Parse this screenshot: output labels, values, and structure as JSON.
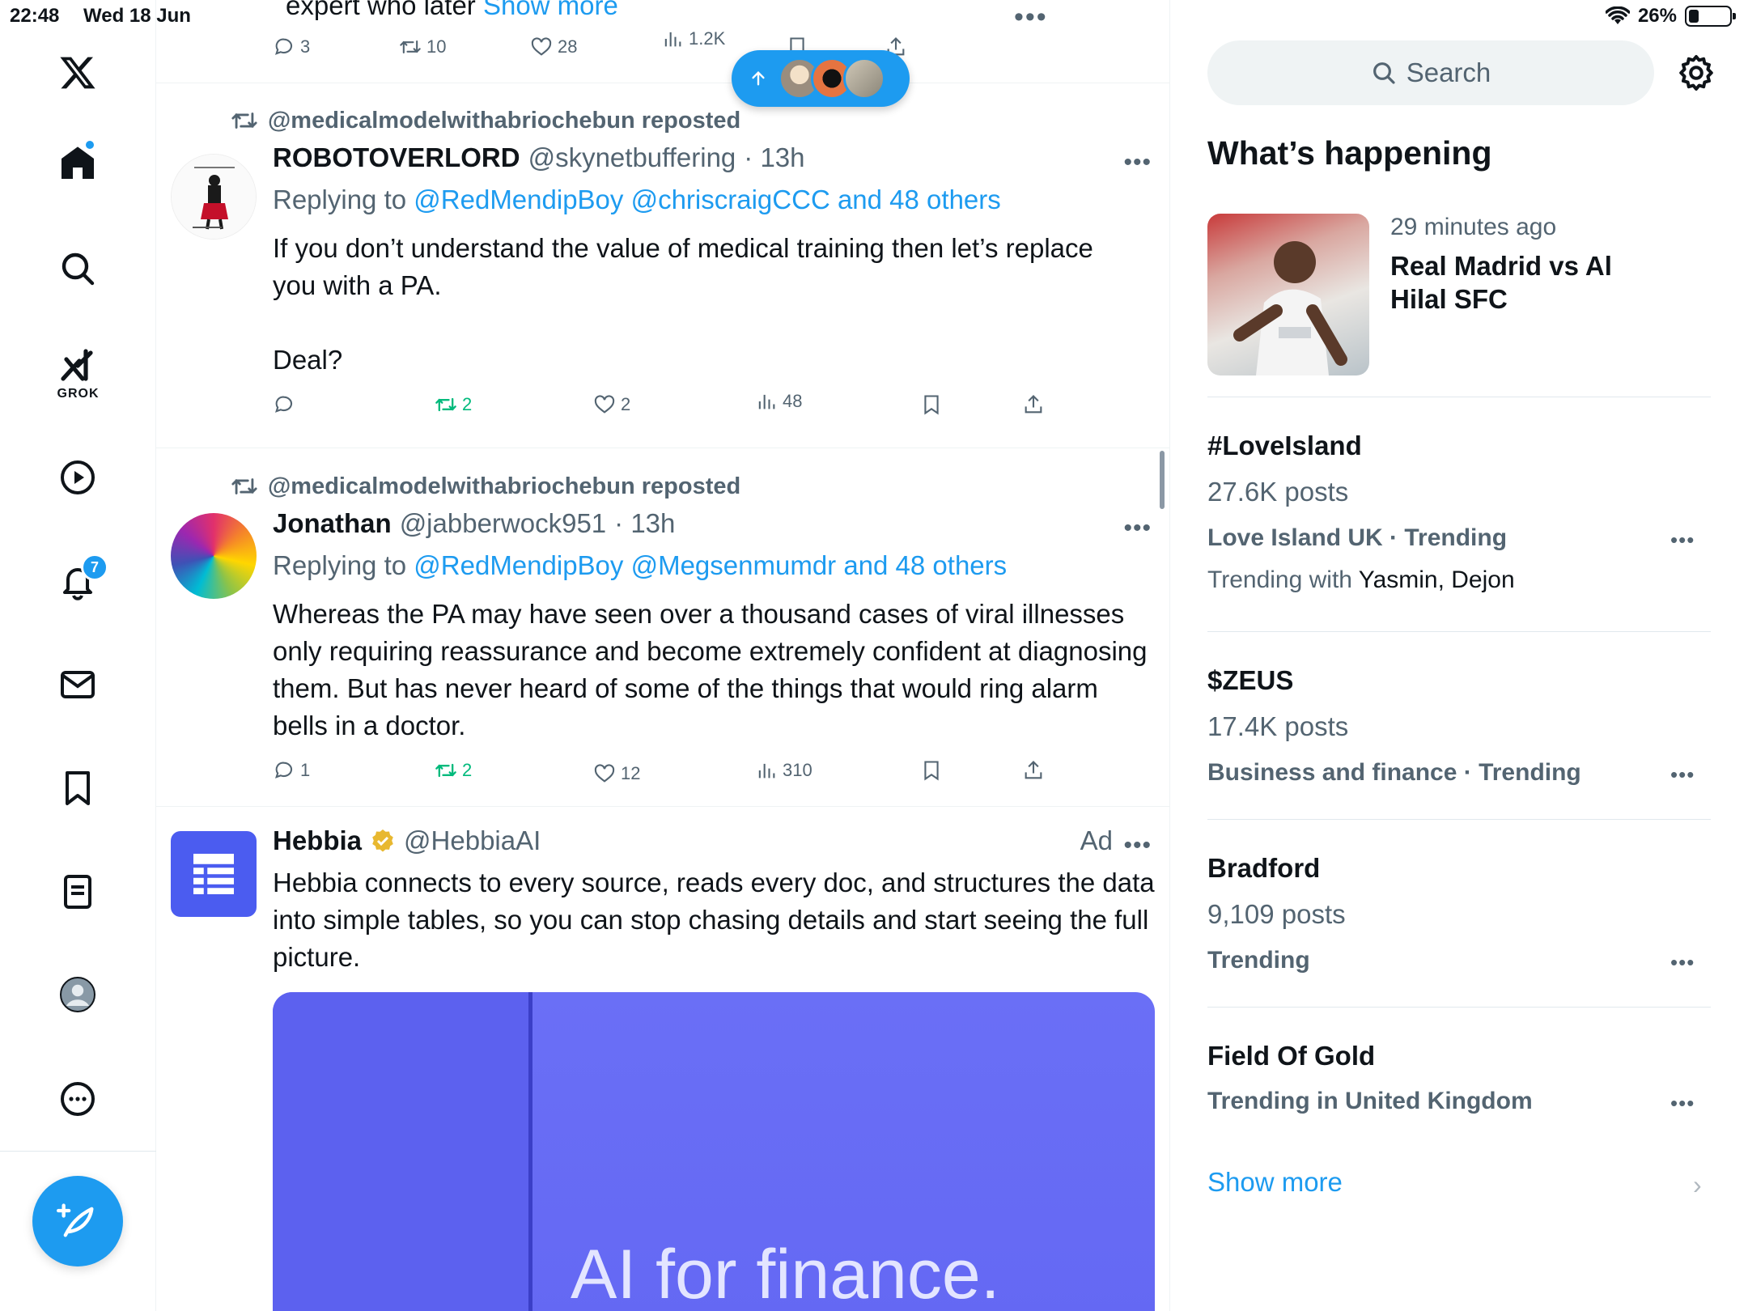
{
  "status": {
    "time": "22:48",
    "date": "Wed 18 Jun",
    "battery": "26%",
    "battery_level": 0.26
  },
  "nav": {
    "grok_label": "GROK",
    "notifications_count": "7"
  },
  "top_tweet_fragment": {
    "text": "expert  who later",
    "show_more": "Show more",
    "replies": "3",
    "reposts": "10",
    "likes": "28",
    "views": "1.2K"
  },
  "tweets": [
    {
      "repost_by": "@medicalmodelwithabriochebun reposted",
      "name": "ROBOTOVERLORD",
      "handle": "@skynetbuffering",
      "time": "· 13h",
      "replying_prefix": "Replying to",
      "replying_links": "@RedMendipBoy @chriscraigCCC and 48 others",
      "text_line1": "If you don’t understand the value of medical training then let’s replace you with a PA.",
      "text_line2": "Deal?",
      "replies": "",
      "reposts": "2",
      "likes": "2",
      "views": "48"
    },
    {
      "repost_by": "@medicalmodelwithabriochebun reposted",
      "name": "Jonathan",
      "handle": "@jabberwock951",
      "time": "· 13h",
      "replying_prefix": "Replying to",
      "replying_links": "@RedMendipBoy @Megsenmumdr and 48 others",
      "text_line1": "Whereas the PA may have seen over a thousand cases of viral illnesses only requiring reassurance and become extremely confident at diagnosing them. But has never heard of some of the things that would ring alarm bells in a doctor.",
      "replies": "1",
      "reposts": "2",
      "likes": "12",
      "views": "310"
    }
  ],
  "ad": {
    "name": "Hebbia",
    "handle": "@HebbiaAI",
    "label": "Ad",
    "text": "Hebbia connects to every source, reads every doc, and structures the data into simple tables, so you can stop chasing details and start seeing the full picture.",
    "headline": "AI for finance."
  },
  "sidebar": {
    "search_placeholder": "Search",
    "title": "What’s happening",
    "news": {
      "time": "29 minutes ago",
      "title": "Real Madrid vs Al Hilal SFC"
    },
    "trends": [
      {
        "name": "#LoveIsland",
        "posts": "27.6K posts",
        "category": "Love Island UK · Trending",
        "with_prefix": "Trending with",
        "with_names": "Yasmin, Dejon"
      },
      {
        "name": "$ZEUS",
        "posts": "17.4K posts",
        "category": "Business and finance · Trending"
      },
      {
        "name": "Bradford",
        "posts": "9,109 posts",
        "category": "Trending"
      },
      {
        "name": "Field Of Gold",
        "category": "Trending in United Kingdom"
      }
    ],
    "show_more": "Show more"
  },
  "colors": {
    "accent": "#1d9bf0",
    "repost_green": "#00ba7c",
    "muted": "#536471",
    "ad_purple": "#6468f3"
  }
}
